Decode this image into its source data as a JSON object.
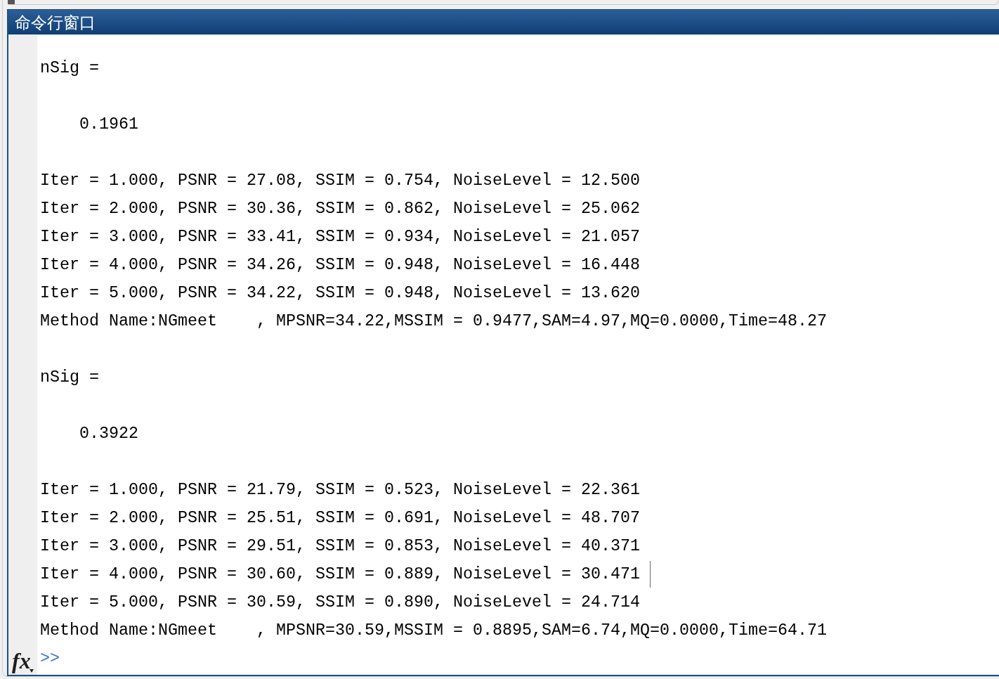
{
  "window": {
    "title": "命令行窗口"
  },
  "blocks": [
    {
      "kind": "variable",
      "lines": [
        {
          "text": "nSig =",
          "caret": false
        }
      ]
    },
    {
      "kind": "value",
      "lines": [
        {
          "text": "0.1961",
          "caret": false
        }
      ]
    },
    {
      "kind": "log",
      "lines": [
        {
          "text": "Iter = 1.000, PSNR = 27.08, SSIM = 0.754, NoiseLevel = 12.500",
          "caret": false
        },
        {
          "text": "Iter = 2.000, PSNR = 30.36, SSIM = 0.862, NoiseLevel = 25.062",
          "caret": false
        },
        {
          "text": "Iter = 3.000, PSNR = 33.41, SSIM = 0.934, NoiseLevel = 21.057",
          "caret": false
        },
        {
          "text": "Iter = 4.000, PSNR = 34.26, SSIM = 0.948, NoiseLevel = 16.448",
          "caret": false
        },
        {
          "text": "Iter = 5.000, PSNR = 34.22, SSIM = 0.948, NoiseLevel = 13.620",
          "caret": false
        },
        {
          "text": "Method Name:NGmeet    , MPSNR=34.22,MSSIM = 0.9477,SAM=4.97,MQ=0.0000,Time=48.27",
          "caret": false
        }
      ]
    },
    {
      "kind": "variable",
      "lines": [
        {
          "text": "nSig =",
          "caret": false
        }
      ]
    },
    {
      "kind": "value",
      "lines": [
        {
          "text": "0.3922",
          "caret": false
        }
      ]
    },
    {
      "kind": "log",
      "lines": [
        {
          "text": "Iter = 1.000, PSNR = 21.79, SSIM = 0.523, NoiseLevel = 22.361",
          "caret": false
        },
        {
          "text": "Iter = 2.000, PSNR = 25.51, SSIM = 0.691, NoiseLevel = 48.707",
          "caret": false
        },
        {
          "text": "Iter = 3.000, PSNR = 29.51, SSIM = 0.853, NoiseLevel = 40.371",
          "caret": false
        },
        {
          "text": "Iter = 4.000, PSNR = 30.60, SSIM = 0.889, NoiseLevel = 30.471",
          "caret": true
        },
        {
          "text": "Iter = 5.000, PSNR = 30.59, SSIM = 0.890, NoiseLevel = 24.714",
          "caret": false
        },
        {
          "text": "Method Name:NGmeet    , MPSNR=30.59,MSSIM = 0.8895,SAM=6.74,MQ=0.0000,Time=64.71",
          "caret": false
        }
      ]
    }
  ],
  "prompt": {
    "function_button": "fx",
    "symbol": ">>"
  }
}
